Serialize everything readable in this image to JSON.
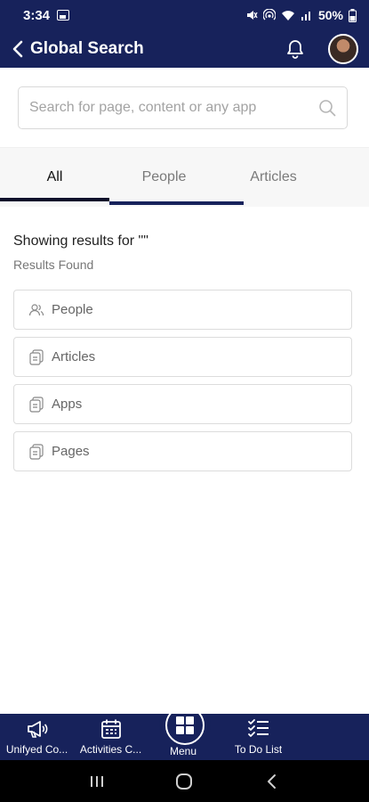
{
  "status_bar": {
    "time": "3:34",
    "battery": "50%"
  },
  "header": {
    "title": "Global Search"
  },
  "search": {
    "placeholder": "Search for page, content or any app",
    "value": ""
  },
  "tabs": [
    {
      "label": "All"
    },
    {
      "label": "People"
    },
    {
      "label": "Articles"
    }
  ],
  "results": {
    "heading": "Showing results for \"\"",
    "count_label": "Results Found",
    "cards": [
      {
        "label": "People",
        "icon": "people-icon"
      },
      {
        "label": "Articles",
        "icon": "document-icon"
      },
      {
        "label": "Apps",
        "icon": "document-icon"
      },
      {
        "label": "Pages",
        "icon": "document-icon"
      }
    ]
  },
  "bottom_nav": [
    {
      "label": "Unifyed Co...",
      "icon": "megaphone-icon"
    },
    {
      "label": "Activities C...",
      "icon": "calendar-icon"
    },
    {
      "label": "Menu",
      "icon": "grid-icon"
    },
    {
      "label": "To Do List",
      "icon": "checklist-icon"
    }
  ],
  "colors": {
    "brand": "#17225b",
    "tab_bg": "#f7f7f7",
    "border": "#dcdcdc"
  }
}
